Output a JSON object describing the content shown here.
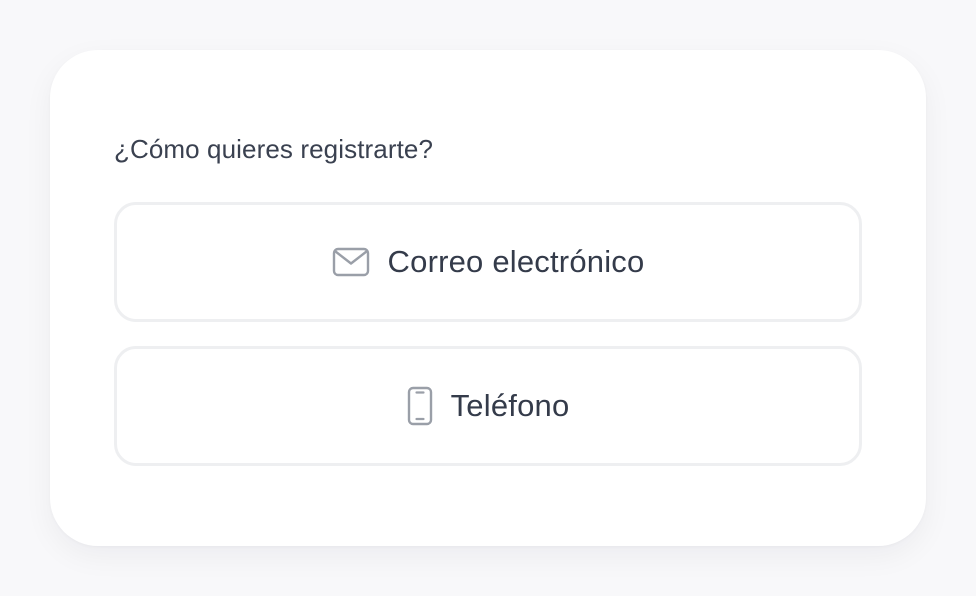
{
  "signup": {
    "question": "¿Cómo quieres registrarte?",
    "options": [
      {
        "label": "Correo electrónico",
        "icon": "mail-icon"
      },
      {
        "label": "Teléfono",
        "icon": "smartphone-icon"
      }
    ]
  },
  "colors": {
    "background": "#f8f8fa",
    "card": "#ffffff",
    "text": "#343b4a",
    "border": "#eeeff1",
    "icon": "#9a9fa8"
  }
}
